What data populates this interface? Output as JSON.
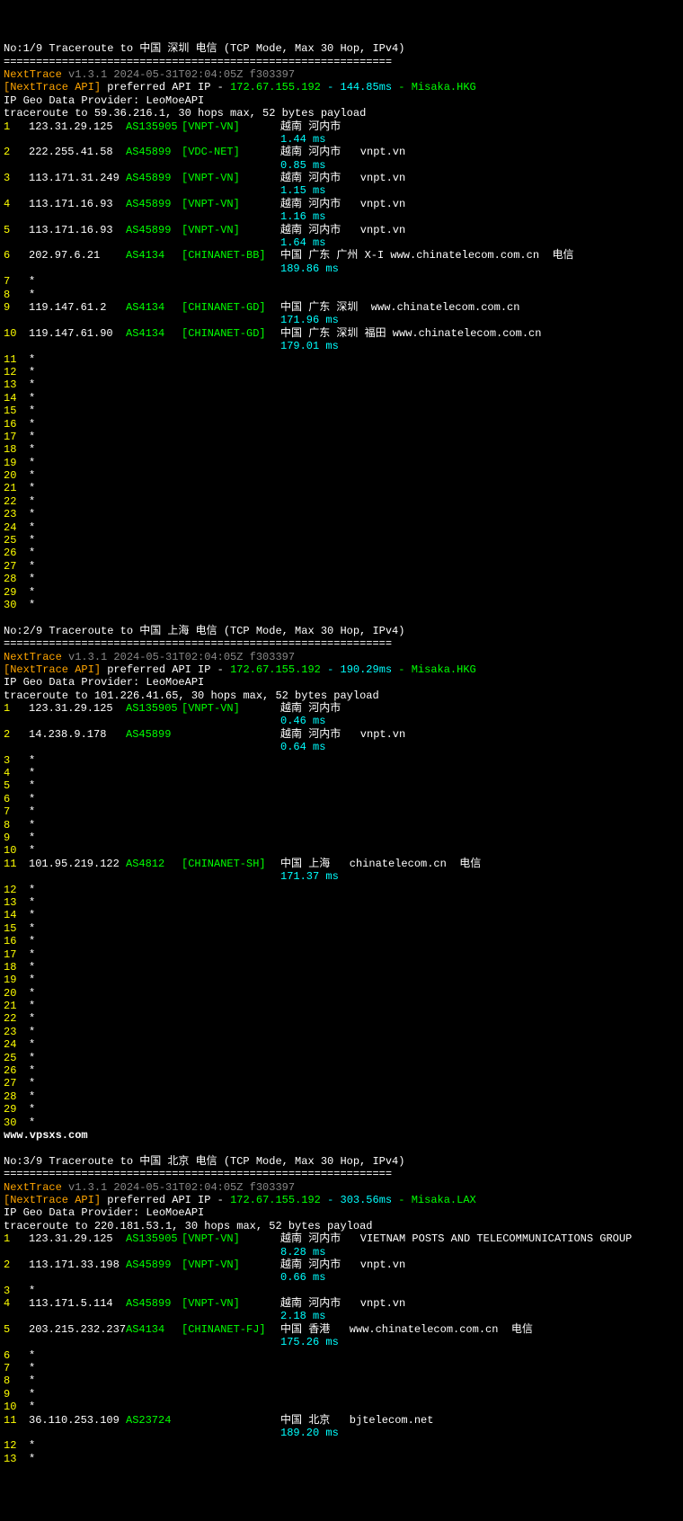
{
  "watermark": "www.vpsxs.com",
  "traces": [
    {
      "header": "No:1/9 Traceroute to 中国 深圳 电信 (TCP Mode, Max 30 Hop, IPv4)",
      "divider": "============================================================",
      "appName": "NextTrace",
      "appVer": "v1.3.1 2024-05-31T02:04:05Z f303397",
      "apiLabel": "[NextTrace API]",
      "apiPref": " preferred API IP - ",
      "apiIp": "172.67.155.192",
      "apiMs": " - 144.85ms",
      "apiLoc": " - Misaka.HKG",
      "geoProvider": "IP Geo Data Provider: LeoMoeAPI",
      "traceInfo": "traceroute to 59.36.216.1, 30 hops max, 52 bytes payload",
      "hops": [
        {
          "n": "1",
          "ip": "123.31.29.125",
          "asn": "AS135905",
          "net": "[VNPT-VN]",
          "loc": "越南 河内市",
          "ms": "1.44 ms"
        },
        {
          "n": "2",
          "ip": "222.255.41.58",
          "asn": "AS45899",
          "net": "[VDC-NET]",
          "loc": "越南 河内市   vnpt.vn",
          "ms": "0.85 ms"
        },
        {
          "n": "3",
          "ip": "113.171.31.249",
          "asn": "AS45899",
          "net": "[VNPT-VN]",
          "loc": "越南 河内市   vnpt.vn",
          "ms": "1.15 ms"
        },
        {
          "n": "4",
          "ip": "113.171.16.93",
          "asn": "AS45899",
          "net": "[VNPT-VN]",
          "loc": "越南 河内市   vnpt.vn",
          "ms": "1.16 ms"
        },
        {
          "n": "5",
          "ip": "113.171.16.93",
          "asn": "AS45899",
          "net": "[VNPT-VN]",
          "loc": "越南 河内市   vnpt.vn",
          "ms": "1.64 ms"
        },
        {
          "n": "6",
          "ip": "202.97.6.21",
          "asn": "AS4134",
          "net": "[CHINANET-BB]",
          "loc": "中国 广东 广州 X-I www.chinatelecom.com.cn  电信",
          "ms": "189.86 ms"
        },
        {
          "n": "7",
          "star": true
        },
        {
          "n": "8",
          "star": true
        },
        {
          "n": "9",
          "ip": "119.147.61.2",
          "asn": "AS4134",
          "net": "[CHINANET-GD]",
          "loc": "中国 广东 深圳  www.chinatelecom.com.cn",
          "ms": "171.96 ms"
        },
        {
          "n": "10",
          "ip": "119.147.61.90",
          "asn": "AS4134",
          "net": "[CHINANET-GD]",
          "loc": "中国 广东 深圳 福田 www.chinatelecom.com.cn",
          "ms": "179.01 ms"
        },
        {
          "n": "11",
          "star": true
        },
        {
          "n": "12",
          "star": true
        },
        {
          "n": "13",
          "star": true
        },
        {
          "n": "14",
          "star": true
        },
        {
          "n": "15",
          "star": true
        },
        {
          "n": "16",
          "star": true
        },
        {
          "n": "17",
          "star": true
        },
        {
          "n": "18",
          "star": true
        },
        {
          "n": "19",
          "star": true
        },
        {
          "n": "20",
          "star": true
        },
        {
          "n": "21",
          "star": true
        },
        {
          "n": "22",
          "star": true
        },
        {
          "n": "23",
          "star": true
        },
        {
          "n": "24",
          "star": true
        },
        {
          "n": "25",
          "star": true
        },
        {
          "n": "26",
          "star": true
        },
        {
          "n": "27",
          "star": true
        },
        {
          "n": "28",
          "star": true
        },
        {
          "n": "29",
          "star": true
        },
        {
          "n": "30",
          "star": true
        }
      ]
    },
    {
      "header": "No:2/9 Traceroute to 中国 上海 电信 (TCP Mode, Max 30 Hop, IPv4)",
      "divider": "============================================================",
      "appName": "NextTrace",
      "appVer": "v1.3.1 2024-05-31T02:04:05Z f303397",
      "apiLabel": "[NextTrace API]",
      "apiPref": " preferred API IP - ",
      "apiIp": "172.67.155.192",
      "apiMs": " - 190.29ms",
      "apiLoc": " - Misaka.HKG",
      "geoProvider": "IP Geo Data Provider: LeoMoeAPI",
      "traceInfo": "traceroute to 101.226.41.65, 30 hops max, 52 bytes payload",
      "hops": [
        {
          "n": "1",
          "ip": "123.31.29.125",
          "asn": "AS135905",
          "net": "[VNPT-VN]",
          "loc": "越南 河内市",
          "ms": "0.46 ms"
        },
        {
          "n": "2",
          "ip": "14.238.9.178",
          "asn": "AS45899",
          "net": "",
          "loc": "越南 河内市   vnpt.vn",
          "ms": "0.64 ms"
        },
        {
          "n": "3",
          "star": true
        },
        {
          "n": "4",
          "star": true
        },
        {
          "n": "5",
          "star": true
        },
        {
          "n": "6",
          "star": true
        },
        {
          "n": "7",
          "star": true
        },
        {
          "n": "8",
          "star": true
        },
        {
          "n": "9",
          "star": true
        },
        {
          "n": "10",
          "star": true
        },
        {
          "n": "11",
          "ip": "101.95.219.122",
          "asn": "AS4812",
          "net": "[CHINANET-SH]",
          "loc": "中国 上海   chinatelecom.cn  电信",
          "ms": "171.37 ms"
        },
        {
          "n": "12",
          "star": true
        },
        {
          "n": "13",
          "star": true
        },
        {
          "n": "14",
          "star": true
        },
        {
          "n": "15",
          "star": true
        },
        {
          "n": "16",
          "star": true
        },
        {
          "n": "17",
          "star": true
        },
        {
          "n": "18",
          "star": true
        },
        {
          "n": "19",
          "star": true
        },
        {
          "n": "20",
          "star": true
        },
        {
          "n": "21",
          "star": true
        },
        {
          "n": "22",
          "star": true
        },
        {
          "n": "23",
          "star": true
        },
        {
          "n": "24",
          "star": true
        },
        {
          "n": "25",
          "star": true
        },
        {
          "n": "26",
          "star": true
        },
        {
          "n": "27",
          "star": true
        },
        {
          "n": "28",
          "star": true
        },
        {
          "n": "29",
          "star": true
        },
        {
          "n": "30",
          "star": true
        }
      ],
      "afterWatermark": true
    },
    {
      "header": "No:3/9 Traceroute to 中国 北京 电信 (TCP Mode, Max 30 Hop, IPv4)",
      "divider": "============================================================",
      "appName": "NextTrace",
      "appVer": "v1.3.1 2024-05-31T02:04:05Z f303397",
      "apiLabel": "[NextTrace API]",
      "apiPref": " preferred API IP - ",
      "apiIp": "172.67.155.192",
      "apiMs": " - 303.56ms",
      "apiLoc": " - Misaka.LAX",
      "geoProvider": "IP Geo Data Provider: LeoMoeAPI",
      "traceInfo": "traceroute to 220.181.53.1, 30 hops max, 52 bytes payload",
      "hops": [
        {
          "n": "1",
          "ip": "123.31.29.125",
          "asn": "AS135905",
          "net": "[VNPT-VN]",
          "loc": "越南 河内市   VIETNAM POSTS AND TELECOMMUNICATIONS GROUP",
          "ms": "8.28 ms"
        },
        {
          "n": "2",
          "ip": "113.171.33.198",
          "asn": "AS45899",
          "net": "[VNPT-VN]",
          "loc": "越南 河内市   vnpt.vn",
          "ms": "0.66 ms"
        },
        {
          "n": "3",
          "star": true
        },
        {
          "n": "4",
          "ip": "113.171.5.114",
          "asn": "AS45899",
          "net": "[VNPT-VN]",
          "loc": "越南 河内市   vnpt.vn",
          "ms": "2.18 ms"
        },
        {
          "n": "5",
          "ip": "203.215.232.237",
          "asn": "AS4134",
          "net": "[CHINANET-FJ]",
          "loc": "中国 香港   www.chinatelecom.com.cn  电信",
          "ms": "175.26 ms"
        },
        {
          "n": "6",
          "star": true
        },
        {
          "n": "7",
          "star": true
        },
        {
          "n": "8",
          "star": true
        },
        {
          "n": "9",
          "star": true
        },
        {
          "n": "10",
          "star": true
        },
        {
          "n": "11",
          "ip": "36.110.253.109",
          "asn": "AS23724",
          "net": "",
          "loc": "中国 北京   bjtelecom.net",
          "ms": "189.20 ms"
        },
        {
          "n": "12",
          "star": true
        },
        {
          "n": "13",
          "star": true
        }
      ]
    }
  ]
}
